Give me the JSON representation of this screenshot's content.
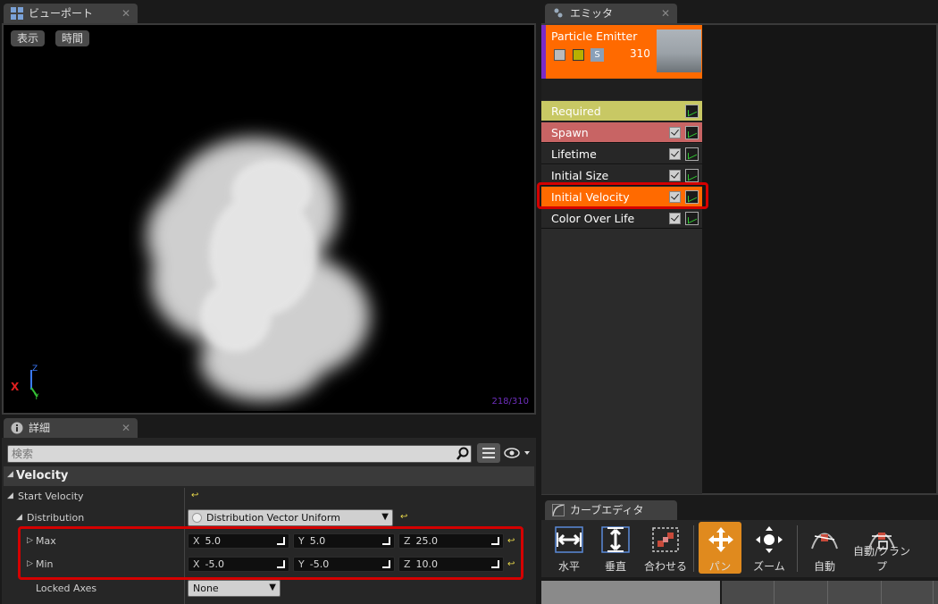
{
  "viewport": {
    "tab_title": "ビューポート",
    "show_button": "表示",
    "time_button": "時間",
    "counter": "218/310",
    "axis_z": "Z",
    "axis_y": "Y",
    "axis_x": "X"
  },
  "details": {
    "tab_title": "詳細",
    "search_placeholder": "検索",
    "category": "Velocity",
    "start_velocity_label": "Start Velocity",
    "distribution_label": "Distribution",
    "distribution_value": "Distribution Vector Uniform",
    "max_label": "Max",
    "min_label": "Min",
    "max": {
      "x": "5.0",
      "y": "5.0",
      "z": "25.0"
    },
    "min": {
      "x": "-5.0",
      "y": "-5.0",
      "z": "10.0"
    },
    "locked_axes_label": "Locked Axes",
    "locked_axes_value": "None"
  },
  "emitters": {
    "tab_title": "エミッタ",
    "emitter_name": "Particle Emitter",
    "emitter_s": "S",
    "emitter_count": "310",
    "modules": [
      {
        "label": "Required",
        "color": "#c8c864",
        "checkbox": false
      },
      {
        "label": "Spawn",
        "color": "#c86464",
        "checkbox": true
      },
      {
        "label": "Lifetime",
        "color": "#272727",
        "checkbox": true
      },
      {
        "label": "Initial Size",
        "color": "#272727",
        "checkbox": true
      },
      {
        "label": "Initial Velocity",
        "color": "#ff6a00",
        "checkbox": true,
        "highlighted": true
      },
      {
        "label": "Color Over Life",
        "color": "#272727",
        "checkbox": true
      }
    ]
  },
  "curve_editor": {
    "tab_title": "カーブエディタ",
    "buttons": [
      "水平",
      "垂直",
      "合わせる",
      "パン",
      "ズーム",
      "自動",
      "自動/クランプ"
    ],
    "active_button": "パン"
  },
  "colors": {
    "highlight_border": "#d40000",
    "accent_orange": "#ff6a00",
    "active_tool": "#e08a1e"
  }
}
